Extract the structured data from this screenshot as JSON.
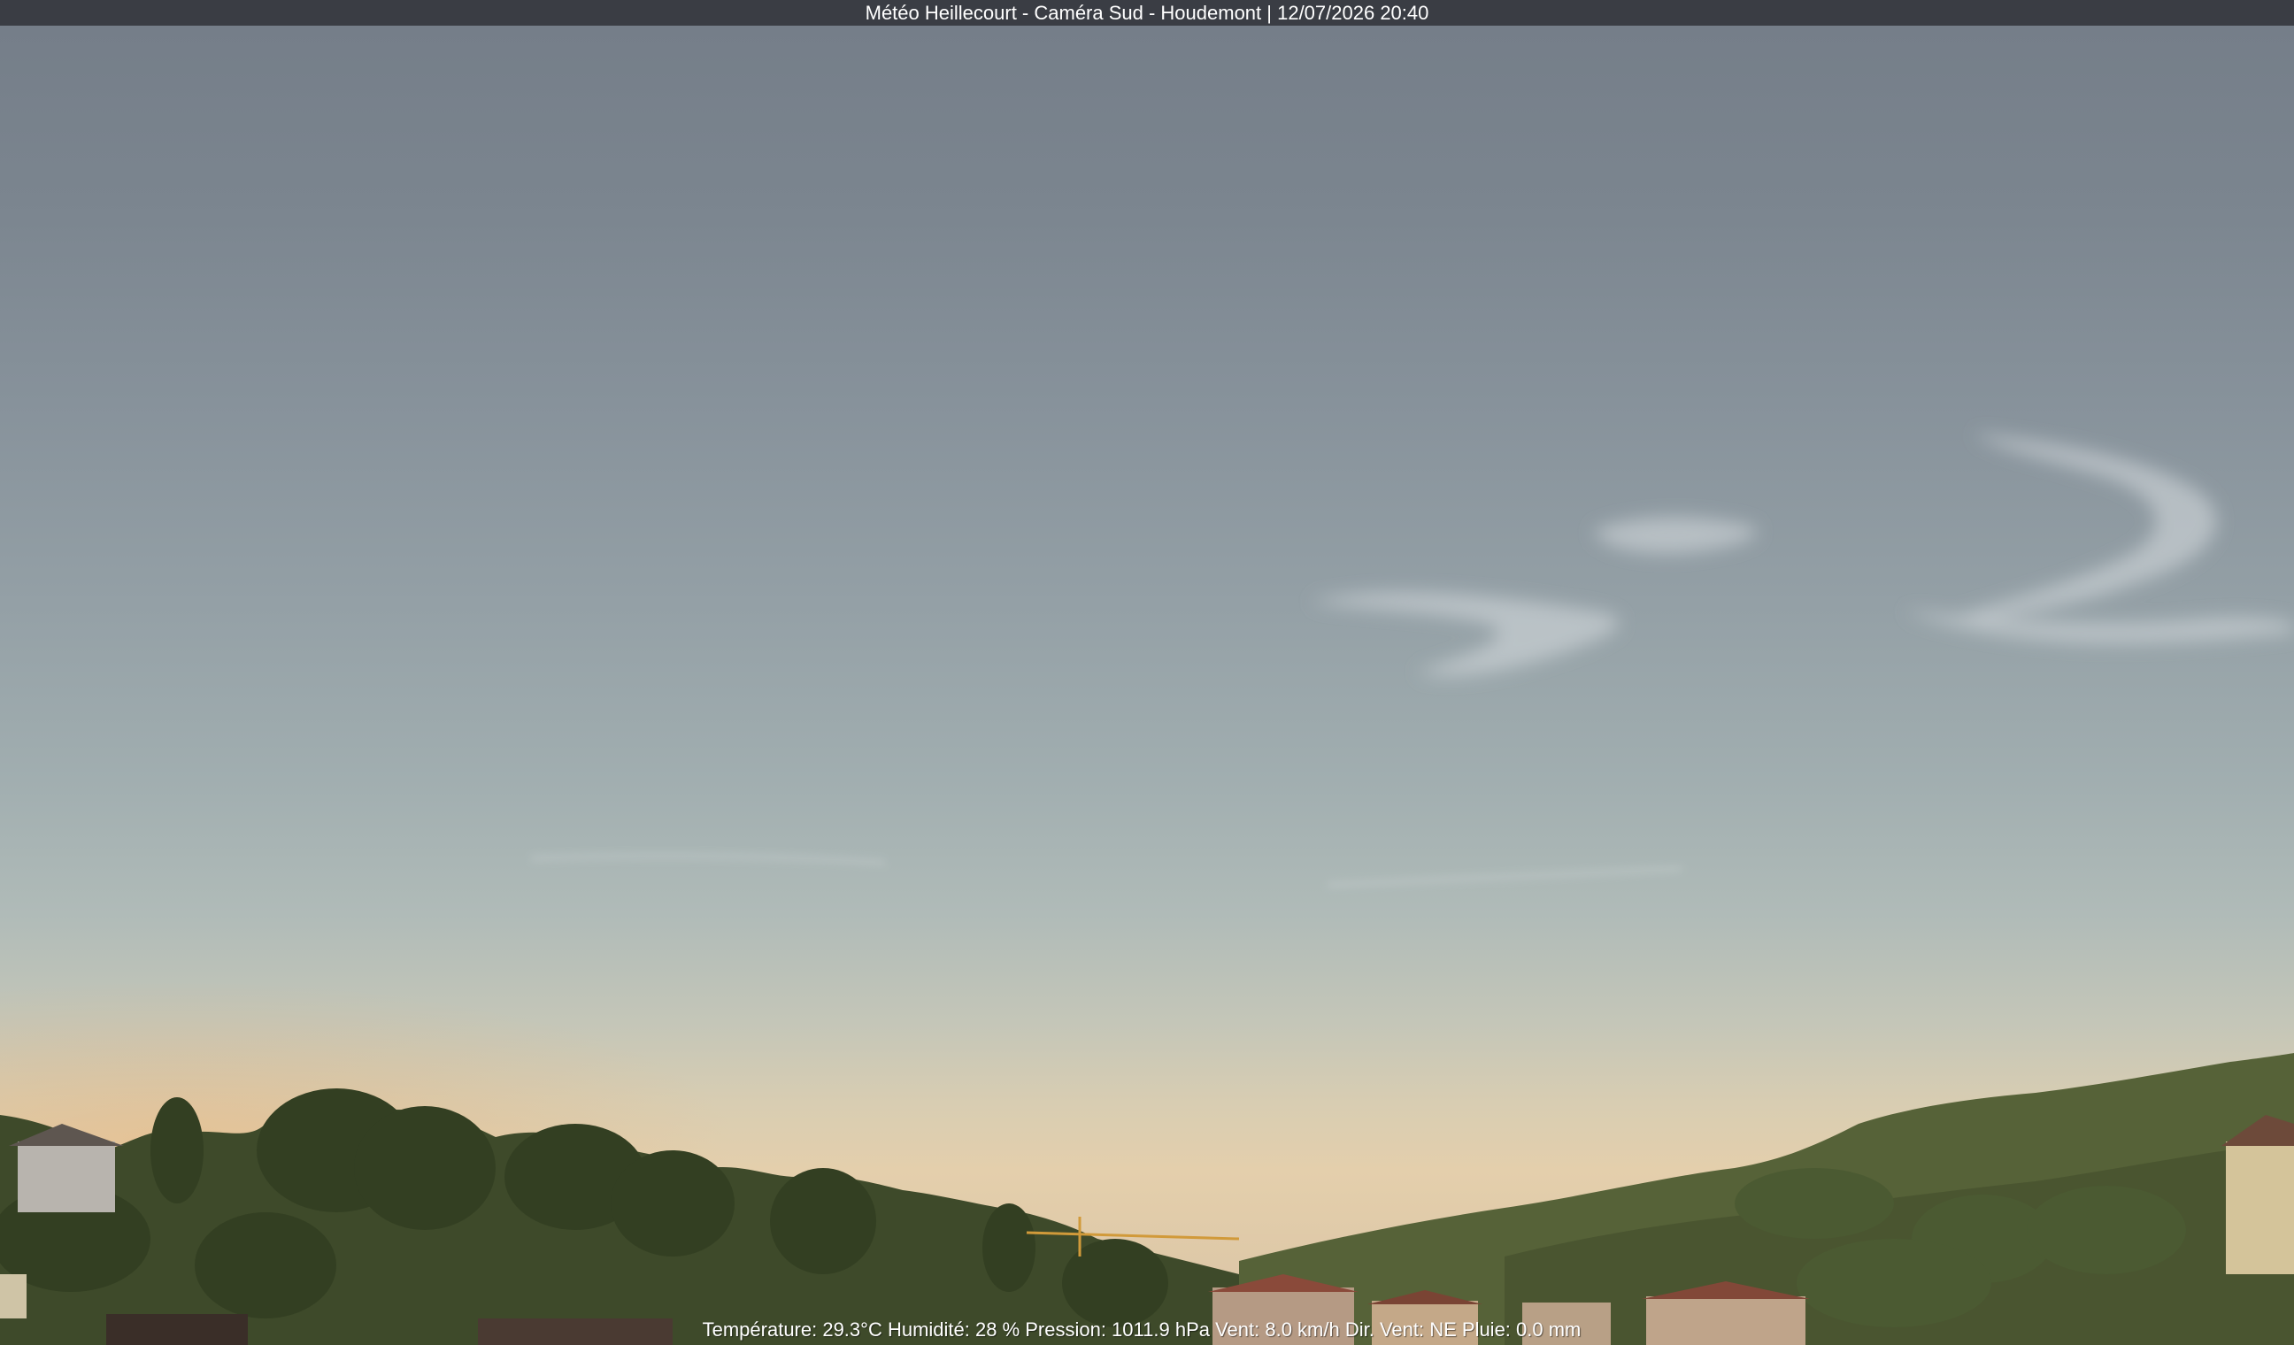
{
  "header": {
    "title": "Météo Heillecourt - Caméra Sud - Houdemont | 12/07/2026 20:40"
  },
  "weather_overlay": {
    "text": "Température: 29.3°C  Humidité: 28 % Pression: 1011.9 hPa Vent: 8.0 km/h Dir. Vent: NE Pluie: 0.0 mm"
  },
  "colors": {
    "title_bar": "#3a3d44",
    "sky_top": "#747d88",
    "sky_horizon": "#e4cfac",
    "trees": "#3c4a2a"
  }
}
